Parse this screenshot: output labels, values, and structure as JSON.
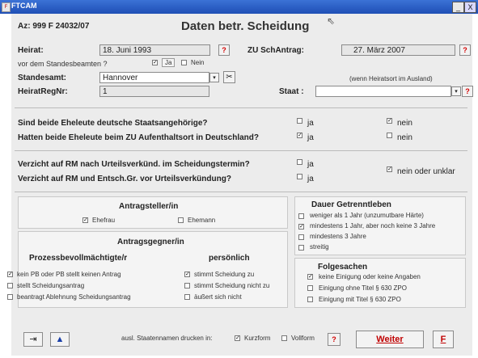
{
  "titlebar": {
    "title": "FTCAM",
    "minimize": "_",
    "close": "X"
  },
  "header": {
    "az": "Az: 999 F 24032/07",
    "title": "Daten betr. Scheidung"
  },
  "heirat": {
    "label": "Heirat:",
    "date": "18. Juni 1993",
    "standesbeamte_q": "vor dem Standesbeamten ?",
    "ja": "Ja",
    "nein": "Nein",
    "zu_label": "ZU SchAntrag:",
    "zu_date": "27. März 2007",
    "standesamt_label": "Standesamt:",
    "standesamt_value": "Hannover",
    "ausland_note": "(wenn Heiratsort im Ausland)",
    "regnr_label": "HeiratRegNr:",
    "regnr_value": "1",
    "staat_label": "Staat :",
    "staat_value": ""
  },
  "questions": {
    "q1": "Sind beide Eheleute deutsche Staatsangehörige?",
    "q2": "Hatten beide Eheleute beim ZU Aufenthaltsort in Deutschland?",
    "q3": "Verzicht auf RM nach Urteilsverkünd. im Scheidungstermin?",
    "q4": "Verzicht auf RM und Entsch.Gr. vor Urteilsverkündung?",
    "ja": "ja",
    "nein": "nein",
    "nein_unklar": "nein oder unklar"
  },
  "antragsteller": {
    "title": "Antragsteller/in",
    "ehefrau": "Ehefrau",
    "ehemann": "Ehemann"
  },
  "antragsgegner": {
    "title": "Antragsgegner/in",
    "pb_title": "Prozessbevollmächtigte/r",
    "pers_title": "persönlich",
    "pb_items": [
      "kein PB oder PB stellt keinen Antrag",
      "stellt Scheidungsantrag",
      "beantragt Ablehnung Scheidungsantrag"
    ],
    "pers_items": [
      "stimmt Scheidung zu",
      "stimmt Scheidung nicht zu",
      "äußert sich nicht"
    ]
  },
  "getrennt": {
    "title": "Dauer Getrenntleben",
    "items": [
      "weniger als 1 Jahr   (unzumutbare Härte)",
      "mindestens 1 Jahr, aber noch keine 3 Jahre",
      "mindestens 3 Jahre",
      "streitig"
    ]
  },
  "folgesachen": {
    "title": "Folgesachen",
    "items": [
      "keine Einigung oder keine Angaben",
      "Einigung ohne Titel § 630 ZPO",
      "Einigung mit Titel § 630 ZPO"
    ]
  },
  "footer": {
    "staatennamen": "ausl. Staatennamen drucken in:",
    "kurzform": "Kurzform",
    "vollform": "Vollform",
    "help": "?",
    "weiter": "Weiter",
    "f": "F",
    "exit_icon": "exit-door-icon",
    "up_icon": "up-arrow-icon"
  },
  "checks": {
    "standesbeamte_ja": true,
    "standesbeamte_nein": false,
    "q1_ja": false,
    "q1_nein": true,
    "q2_ja": true,
    "q2_nein": false,
    "q3_ja": false,
    "q4_ja": false,
    "q34_nein": true,
    "ehefrau": true,
    "ehemann": false,
    "pb": [
      true,
      false,
      false
    ],
    "pers": [
      true,
      false,
      false
    ],
    "getrennt": [
      false,
      true,
      false,
      false
    ],
    "folgesachen": [
      true,
      false,
      false
    ],
    "kurzform": true,
    "vollform": false
  },
  "colors": {
    "titlebar": "#2455c3",
    "question_red": "#d40000",
    "weiter_red": "#c00000",
    "panel": "#ececec"
  }
}
